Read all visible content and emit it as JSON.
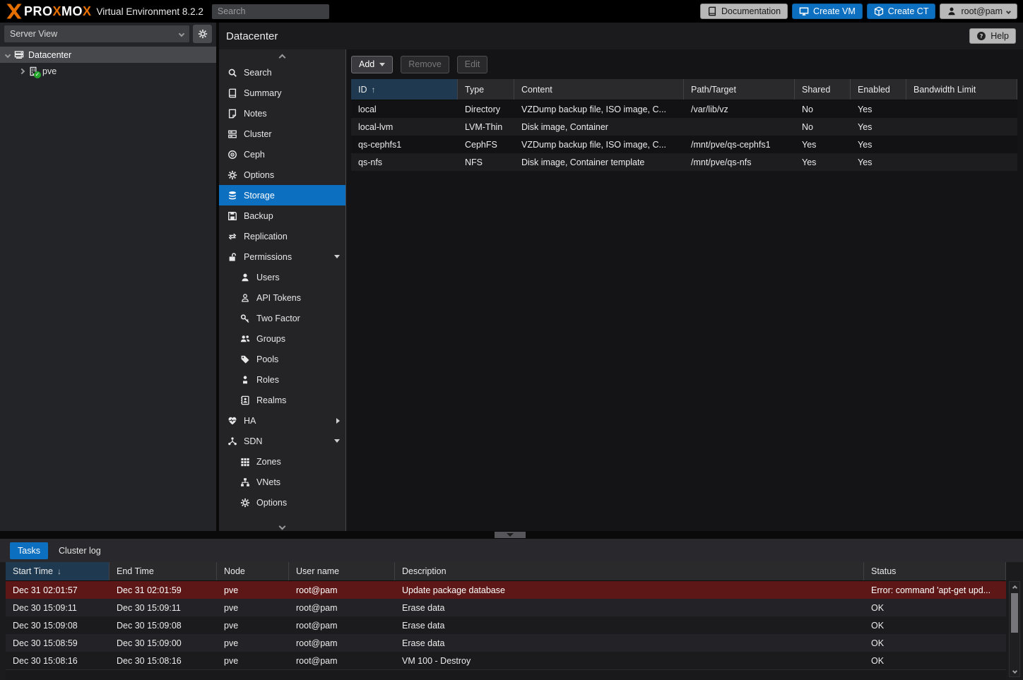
{
  "topbar": {
    "logo_parts": [
      "PRO",
      "X",
      "MO",
      "X"
    ],
    "version_text": "Virtual Environment 8.2.2",
    "search_placeholder": "Search",
    "documentation_label": "Documentation",
    "create_vm_label": "Create VM",
    "create_ct_label": "Create CT",
    "user_label": "root@pam"
  },
  "sidebar": {
    "view_select_value": "Server View",
    "tree": [
      {
        "label": "Datacenter",
        "icon": "server-icon",
        "selected": true
      },
      {
        "label": "pve",
        "icon": "building-icon",
        "status": "ok"
      }
    ]
  },
  "content": {
    "title": "Datacenter",
    "help_label": "Help"
  },
  "nav": {
    "items": [
      {
        "label": "Search",
        "icon": "search-icon"
      },
      {
        "label": "Summary",
        "icon": "book-icon"
      },
      {
        "label": "Notes",
        "icon": "note-icon"
      },
      {
        "label": "Cluster",
        "icon": "cluster-icon"
      },
      {
        "label": "Ceph",
        "icon": "ceph-icon"
      },
      {
        "label": "Options",
        "icon": "gear-icon"
      },
      {
        "label": "Storage",
        "icon": "database-icon",
        "selected": true
      },
      {
        "label": "Backup",
        "icon": "floppy-icon"
      },
      {
        "label": "Replication",
        "icon": "replication-icon"
      },
      {
        "label": "Permissions",
        "icon": "unlock-icon",
        "caret": "down"
      },
      {
        "label": "Users",
        "icon": "user-icon",
        "indent": 1
      },
      {
        "label": "API Tokens",
        "icon": "user-outline-icon",
        "indent": 1
      },
      {
        "label": "Two Factor",
        "icon": "key-icon",
        "indent": 1
      },
      {
        "label": "Groups",
        "icon": "users-icon",
        "indent": 1
      },
      {
        "label": "Pools",
        "icon": "tag-icon",
        "indent": 1
      },
      {
        "label": "Roles",
        "icon": "role-icon",
        "indent": 1
      },
      {
        "label": "Realms",
        "icon": "address-book-icon",
        "indent": 1
      },
      {
        "label": "HA",
        "icon": "heartbeat-icon",
        "caret": "right"
      },
      {
        "label": "SDN",
        "icon": "sdn-icon",
        "caret": "down"
      },
      {
        "label": "Zones",
        "icon": "grid-icon",
        "indent": 1
      },
      {
        "label": "VNets",
        "icon": "vnet-icon",
        "indent": 1
      },
      {
        "label": "Options",
        "icon": "gear-icon",
        "indent": 1
      }
    ]
  },
  "storage": {
    "toolbar": {
      "add": "Add",
      "remove": "Remove",
      "edit": "Edit"
    },
    "columns": [
      "ID",
      "Type",
      "Content",
      "Path/Target",
      "Shared",
      "Enabled",
      "Bandwidth Limit"
    ],
    "sort": {
      "column": "ID",
      "direction": "asc",
      "arrow": "↑"
    },
    "rows": [
      {
        "id": "local",
        "type": "Directory",
        "content": "VZDump backup file, ISO image, C...",
        "path": "/var/lib/vz",
        "shared": "No",
        "enabled": "Yes",
        "bandwidth": ""
      },
      {
        "id": "local-lvm",
        "type": "LVM-Thin",
        "content": "Disk image, Container",
        "path": "",
        "shared": "No",
        "enabled": "Yes",
        "bandwidth": ""
      },
      {
        "id": "qs-cephfs1",
        "type": "CephFS",
        "content": "VZDump backup file, ISO image, C...",
        "path": "/mnt/pve/qs-cephfs1",
        "shared": "Yes",
        "enabled": "Yes",
        "bandwidth": ""
      },
      {
        "id": "qs-nfs",
        "type": "NFS",
        "content": "Disk image, Container template",
        "path": "/mnt/pve/qs-nfs",
        "shared": "Yes",
        "enabled": "Yes",
        "bandwidth": ""
      }
    ]
  },
  "tasks": {
    "tabs": [
      {
        "label": "Tasks",
        "active": true
      },
      {
        "label": "Cluster log"
      }
    ],
    "columns": [
      "Start Time",
      "End Time",
      "Node",
      "User name",
      "Description",
      "Status"
    ],
    "sort": {
      "column": "Start Time",
      "direction": "desc",
      "arrow": "↓"
    },
    "rows": [
      {
        "start": "Dec 31 02:01:57",
        "end": "Dec 31 02:01:59",
        "node": "pve",
        "user": "root@pam",
        "desc": "Update package database",
        "status": "Error: command 'apt-get upd...",
        "error": true
      },
      {
        "start": "Dec 30 15:09:11",
        "end": "Dec 30 15:09:11",
        "node": "pve",
        "user": "root@pam",
        "desc": "Erase data",
        "status": "OK"
      },
      {
        "start": "Dec 30 15:09:08",
        "end": "Dec 30 15:09:08",
        "node": "pve",
        "user": "root@pam",
        "desc": "Erase data",
        "status": "OK"
      },
      {
        "start": "Dec 30 15:08:59",
        "end": "Dec 30 15:09:00",
        "node": "pve",
        "user": "root@pam",
        "desc": "Erase data",
        "status": "OK"
      },
      {
        "start": "Dec 30 15:08:16",
        "end": "Dec 30 15:08:16",
        "node": "pve",
        "user": "root@pam",
        "desc": "VM 100 - Destroy",
        "status": "OK"
      }
    ]
  },
  "colors": {
    "accent_blue": "#0d6fc0",
    "brand_orange": "#e57000",
    "error_row": "#5e1717",
    "sorted_header": "#1f3a50",
    "selected_tree_row": "#47484c"
  }
}
